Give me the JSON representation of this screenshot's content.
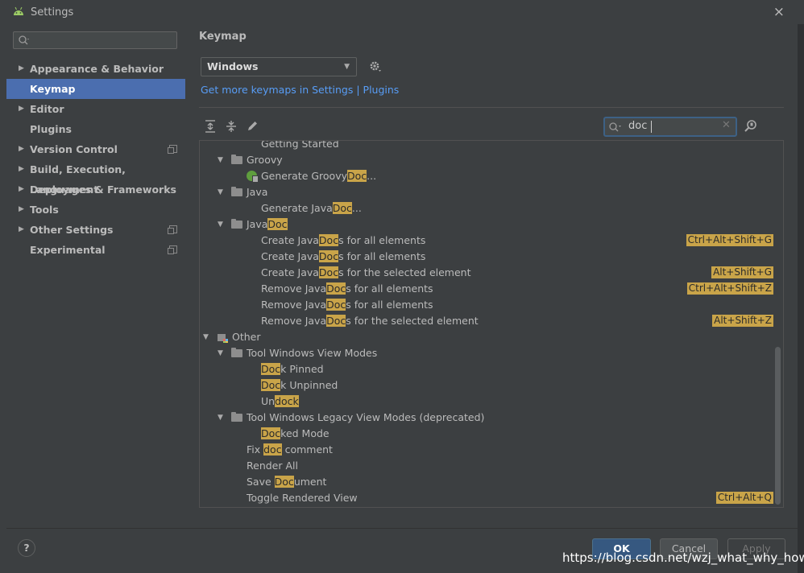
{
  "window": {
    "title": "Settings",
    "close_symbol": "×"
  },
  "sidebar": {
    "search_placeholder": "",
    "items": [
      {
        "label": "Appearance & Behavior",
        "expandable": true,
        "project": false
      },
      {
        "label": "Keymap",
        "expandable": false,
        "selected": true,
        "project": false
      },
      {
        "label": "Editor",
        "expandable": true,
        "project": false
      },
      {
        "label": "Plugins",
        "expandable": false,
        "project": false
      },
      {
        "label": "Version Control",
        "expandable": true,
        "project": true
      },
      {
        "label": "Build, Execution, Deployment",
        "expandable": true,
        "project": false
      },
      {
        "label": "Languages & Frameworks",
        "expandable": true,
        "project": false
      },
      {
        "label": "Tools",
        "expandable": true,
        "project": false
      },
      {
        "label": "Other Settings",
        "expandable": true,
        "project": true
      },
      {
        "label": "Experimental",
        "expandable": false,
        "project": true
      }
    ]
  },
  "main": {
    "title": "Keymap",
    "keymap_value": "Windows",
    "more_keymaps_link": "Get more keymaps in Settings | Plugins",
    "search_value": "doc"
  },
  "tree": [
    {
      "level": 3,
      "parts": [
        "Getting Started"
      ],
      "partial": true
    },
    {
      "level": 2,
      "folder": true,
      "expanded": true,
      "parts": [
        "Groovy"
      ]
    },
    {
      "level": 3,
      "icon": "groovy",
      "parts": [
        "Generate Groovy",
        "*Doc",
        "..."
      ]
    },
    {
      "level": 2,
      "folder": true,
      "expanded": true,
      "parts": [
        "Java"
      ]
    },
    {
      "level": 3,
      "parts": [
        "Generate Java",
        "*Doc",
        "..."
      ]
    },
    {
      "level": 2,
      "folder": true,
      "expanded": true,
      "parts": [
        "Java",
        "*Doc"
      ]
    },
    {
      "level": 3,
      "parts": [
        "Create Java",
        "*Doc",
        "s for all elements"
      ],
      "shortcut": "Ctrl+Alt+Shift+G"
    },
    {
      "level": 3,
      "parts": [
        "Create Java",
        "*Doc",
        "s for all elements"
      ]
    },
    {
      "level": 3,
      "parts": [
        "Create Java",
        "*Doc",
        "s for the selected element"
      ],
      "shortcut": "Alt+Shift+G"
    },
    {
      "level": 3,
      "parts": [
        "Remove Java",
        "*Doc",
        "s for all elements"
      ],
      "shortcut": "Ctrl+Alt+Shift+Z"
    },
    {
      "level": 3,
      "parts": [
        "Remove Java",
        "*Doc",
        "s for all elements"
      ]
    },
    {
      "level": 3,
      "parts": [
        "Remove Java",
        "*Doc",
        "s for the selected element"
      ],
      "shortcut": "Alt+Shift+Z"
    },
    {
      "level": 1,
      "other": true,
      "expanded": true,
      "parts": [
        "Other"
      ]
    },
    {
      "level": 2,
      "folder": true,
      "expanded": true,
      "parts": [
        "Tool Windows View Modes"
      ]
    },
    {
      "level": 3,
      "parts": [
        "*Doc",
        "k Pinned"
      ]
    },
    {
      "level": 3,
      "parts": [
        "*Doc",
        "k Unpinned"
      ]
    },
    {
      "level": 3,
      "parts": [
        "Un",
        "*dock"
      ]
    },
    {
      "level": 2,
      "folder": true,
      "expanded": true,
      "parts": [
        "Tool Windows Legacy View Modes (deprecated)"
      ]
    },
    {
      "level": 3,
      "parts": [
        "*Doc",
        "ked Mode"
      ]
    },
    {
      "level": 2,
      "parts": [
        "Fix ",
        "*doc",
        " comment"
      ]
    },
    {
      "level": 2,
      "parts": [
        "Render All"
      ]
    },
    {
      "level": 2,
      "parts": [
        "Save ",
        "*Doc",
        "ument"
      ]
    },
    {
      "level": 2,
      "parts": [
        "Toggle Rendered View"
      ],
      "shortcut": "Ctrl+Alt+Q"
    }
  ],
  "buttons": {
    "help": "?",
    "ok": "OK",
    "cancel": "Cancel",
    "apply": "Apply"
  },
  "watermark": "https://blog.csdn.net/wzj_what_why_how",
  "colors": {
    "background": "#3c3f41",
    "selection": "#4b6eaf",
    "link": "#589df6",
    "highlight": "#c9a449",
    "ok_button": "#365880"
  },
  "icons": {
    "app": "android-icon",
    "search": "search-icon",
    "gear": "gear-icon",
    "expand_all": "expand-all-icon",
    "collapse_all": "collapse-all-icon",
    "edit": "pencil-icon",
    "find_shortcut": "find-by-shortcut-icon"
  }
}
